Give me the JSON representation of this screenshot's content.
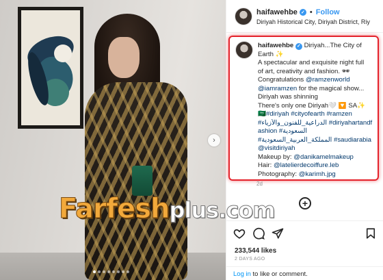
{
  "colors": {
    "accent_blue": "#3897f0",
    "highlight_red": "#e4222b",
    "mention_blue": "#00376b",
    "watermark_orange": "#f2a93b"
  },
  "photo": {
    "slide_dots": 8,
    "active_dot": 0,
    "next_icon": "chevron-right-icon"
  },
  "watermark": {
    "brand": "Farfesh",
    "suffix": "plus.com"
  },
  "header": {
    "username": "haifawehbe",
    "separator": "•",
    "follow_label": "Follow",
    "location": "Diriyah Historical City, Diriyah District, Riy"
  },
  "caption": {
    "username": "haifawehbe",
    "first_line": "Diriyah...The City of",
    "lines": [
      "Earth ✨",
      "A spectacular and exquisite night full",
      "of art, creativity and fashion. 🕶",
      "Congratulations",
      "for the magical show...",
      "Diriyah was shinning",
      "There's only one Diriyah🤍 🔽 SA✨",
      "🇸🇦#diriyah #cityofearth #ramzen",
      "#الدراعية_للفنون_والأزياء #diriyahartandf",
      "ashion #السعودية",
      "#المملكة_العربية_السعودية #saudiarabia",
      "Makeup by:",
      "Hair:",
      "Photography:"
    ],
    "mentions": {
      "ramzenworld": "@ramzenworld",
      "iamramzen": "@iamramzen",
      "visitdiriyah": "@visitdiriyah",
      "makeup": "@danikamelmakeup",
      "hair": "@latelierdecoiffure.leb",
      "photo": "@karimh.jpg"
    },
    "age": "2d"
  },
  "actions": {
    "icons": [
      "heart-icon",
      "comment-icon",
      "share-icon",
      "bookmark-icon"
    ],
    "more_label": "+"
  },
  "stats": {
    "likes": "233,544 likes",
    "date": "2 DAYS AGO"
  },
  "login": {
    "link": "Log in",
    "text": " to like or comment."
  }
}
